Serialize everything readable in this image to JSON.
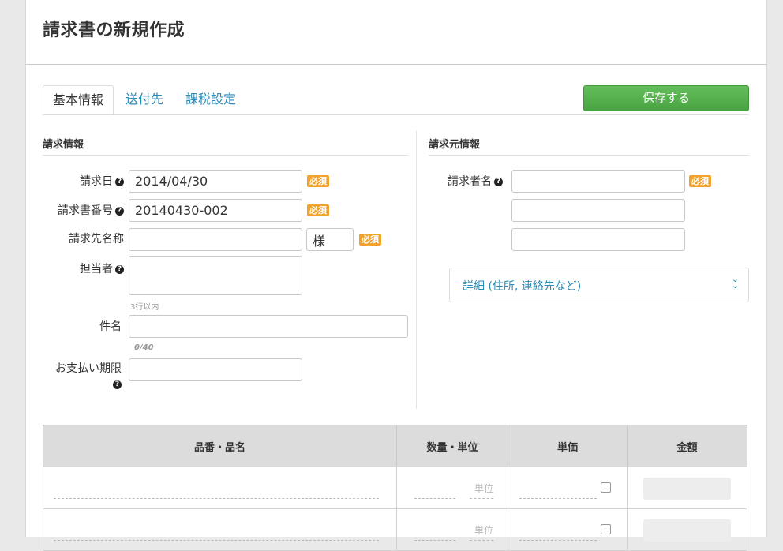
{
  "page_title": "請求書の新規作成",
  "tabs": [
    {
      "label": "基本情報",
      "active": true
    },
    {
      "label": "送付先",
      "active": false
    },
    {
      "label": "課税設定",
      "active": false
    }
  ],
  "save_button": "保存する",
  "billing_info": {
    "title": "請求情報",
    "invoice_date": {
      "label": "請求日",
      "value": "2014/04/30",
      "badge": "必須"
    },
    "invoice_number": {
      "label": "請求書番号",
      "value": "20140430-002",
      "badge": "必須"
    },
    "recipient_name": {
      "label": "請求先名称",
      "value": "",
      "honorific": "様",
      "badge": "必須"
    },
    "contact_person": {
      "label": "担当者",
      "value": "",
      "hint": "3行以内"
    },
    "subject": {
      "label": "件名",
      "value": "",
      "counter": "0/40"
    },
    "payment_due": {
      "label": "お支払い期限",
      "value": ""
    }
  },
  "issuer_info": {
    "title": "請求元情報",
    "issuer_name": {
      "label": "請求者名",
      "badge": "必須"
    },
    "details_toggle": "詳細 (住所, 連絡先など)"
  },
  "items_table": {
    "headers": [
      "品番・品名",
      "数量・単位",
      "単価",
      "金額"
    ],
    "unit_placeholder": "単位",
    "rows": 2
  },
  "colors": {
    "accent_link": "#2a8ab8",
    "save_green": "#4aa342",
    "required_badge": "#f0a22b"
  },
  "icons": {
    "help": "help-circle-icon",
    "chevron": "double-chevron-down-icon"
  }
}
